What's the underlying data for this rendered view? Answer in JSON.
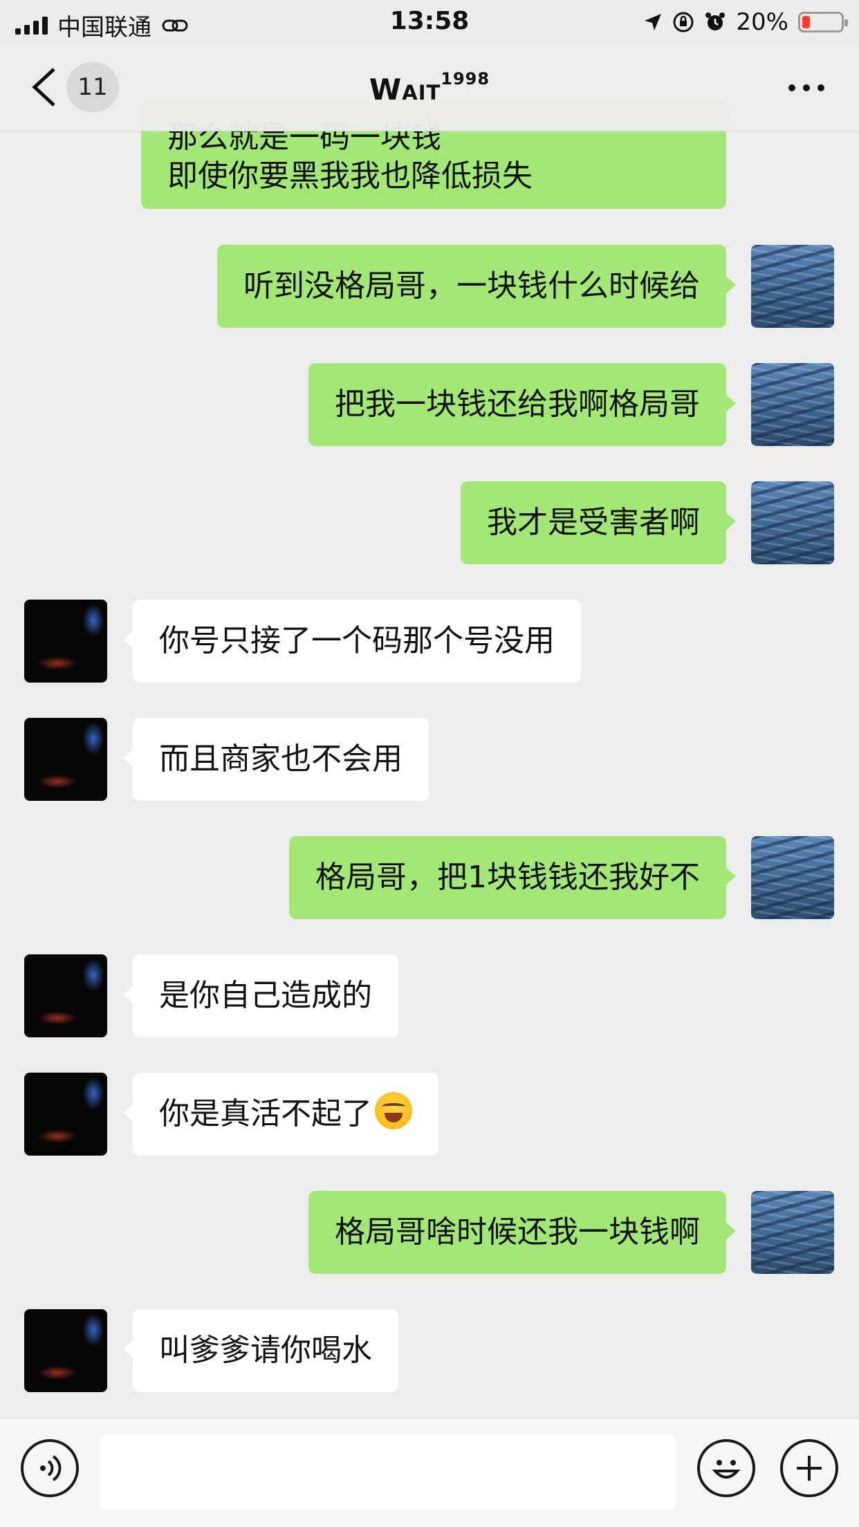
{
  "status_bar": {
    "carrier": "中国联通",
    "time": "13:58",
    "battery": "20%",
    "battery_level": 0.2,
    "icons": [
      "signal-icon",
      "hotspot-icon",
      "location-icon",
      "orientation-lock-icon",
      "alarm-icon",
      "battery-icon"
    ]
  },
  "nav": {
    "back_icon": "chevron-left-icon",
    "unread_count": "11",
    "title": "Wait",
    "title_sup": "1998",
    "more_icon": "more-dots-icon"
  },
  "messages": {
    "first": {
      "line1": "那么就是一码一块钱",
      "line2": "即使你要黑我我也降低损失"
    },
    "items": [
      {
        "side": "right",
        "text": "听到没格局哥，一块钱什么时候给"
      },
      {
        "side": "right",
        "text": "把我一块钱还给我啊格局哥"
      },
      {
        "side": "right",
        "text": "我才是受害者啊"
      },
      {
        "side": "left",
        "text": "你号只接了一个码那个号没用"
      },
      {
        "side": "left",
        "text": "而且商家也不会用"
      },
      {
        "side": "right",
        "text": "格局哥，把1块钱钱还我好不"
      },
      {
        "side": "left",
        "text": "是你自己造成的"
      },
      {
        "side": "left",
        "text": "你是真活不起了",
        "emoji": "facepalm-emoji"
      },
      {
        "side": "right",
        "text": "格局哥啥时候还我一块钱啊"
      },
      {
        "side": "left",
        "text": "叫爹爹请你喝水"
      }
    ]
  },
  "input_bar": {
    "voice_icon": "voice-icon",
    "text_value": "",
    "emoji_icon": "emoji-icon",
    "plus_icon": "plus-icon"
  },
  "colors": {
    "background": "#ededed",
    "sent_bubble": "#a3e876",
    "received_bubble": "#ffffff"
  }
}
